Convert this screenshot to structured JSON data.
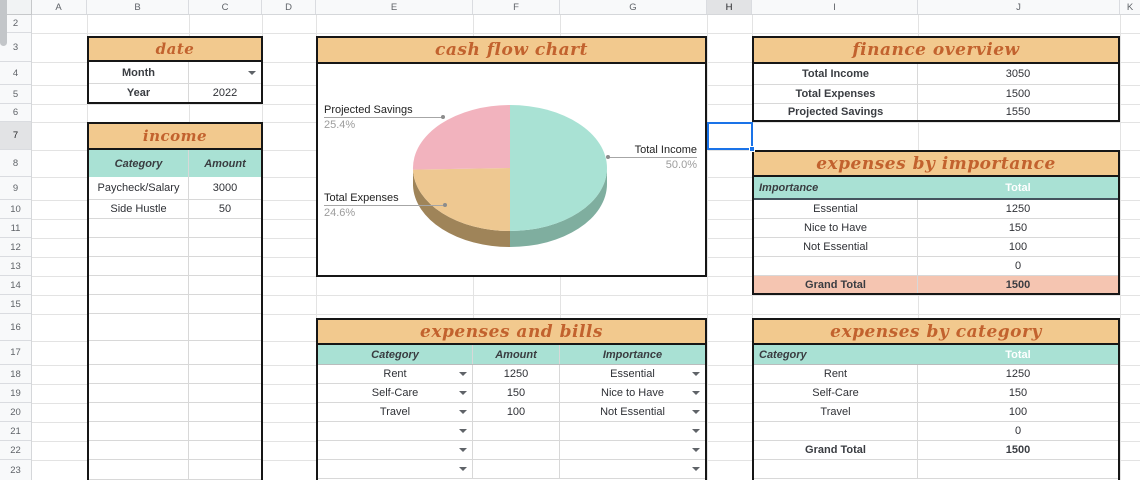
{
  "spreadsheet": {
    "column_headers": [
      "A",
      "B",
      "C",
      "D",
      "E",
      "F",
      "G",
      "H",
      "I",
      "J",
      "K"
    ],
    "row_headers": [
      "2",
      "3",
      "4",
      "5",
      "6",
      "7",
      "8",
      "9",
      "10",
      "11",
      "12",
      "13",
      "14",
      "15",
      "16",
      "17",
      "18",
      "19",
      "20",
      "21",
      "22",
      "23"
    ],
    "selected": {
      "column": "H",
      "row": "7"
    }
  },
  "date_table": {
    "title": "date",
    "month_label": "Month",
    "month_value": "",
    "year_label": "Year",
    "year_value": "2022"
  },
  "income_table": {
    "title": "income",
    "col1": "Category",
    "col2": "Amount",
    "rows": [
      {
        "category": "Paycheck/Salary",
        "amount": "3000"
      },
      {
        "category": "Side Hustle",
        "amount": "50"
      }
    ]
  },
  "cash_flow_chart": {
    "title": "cash flow chart",
    "labels": {
      "projected_savings": {
        "name": "Projected Savings",
        "pct": "25.4%"
      },
      "total_expenses": {
        "name": "Total Expenses",
        "pct": "24.6%"
      },
      "total_income": {
        "name": "Total Income",
        "pct": "50.0%"
      }
    }
  },
  "chart_data": {
    "type": "pie",
    "title": "cash flow chart",
    "slices": [
      {
        "label": "Total Income",
        "value": 50.0,
        "color": "#a9e2d4"
      },
      {
        "label": "Projected Savings",
        "value": 25.4,
        "color": "#f2b3be"
      },
      {
        "label": "Total Expenses",
        "value": 24.6,
        "color": "#eec891"
      }
    ],
    "style_3d": true,
    "legend": "outside-labels"
  },
  "finance_overview": {
    "title": "finance overview",
    "rows": [
      {
        "label": "Total Income",
        "value": "3050"
      },
      {
        "label": "Total Expenses",
        "value": "1500"
      },
      {
        "label": "Projected Savings",
        "value": "1550"
      }
    ]
  },
  "expenses_by_importance": {
    "title": "expenses by importance",
    "col1": "Importance",
    "col2": "Total",
    "rows": [
      {
        "label": "Essential",
        "value": "1250"
      },
      {
        "label": "Nice to Have",
        "value": "150"
      },
      {
        "label": "Not Essential",
        "value": "100"
      },
      {
        "label": "",
        "value": "0"
      }
    ],
    "grand_total_label": "Grand Total",
    "grand_total_value": "1500"
  },
  "expenses_and_bills": {
    "title": "expenses and bills",
    "col1": "Category",
    "col2": "Amount",
    "col3": "Importance",
    "rows": [
      {
        "category": "Rent",
        "amount": "1250",
        "importance": "Essential"
      },
      {
        "category": "Self-Care",
        "amount": "150",
        "importance": "Nice to Have"
      },
      {
        "category": "Travel",
        "amount": "100",
        "importance": "Not Essential"
      },
      {
        "category": "",
        "amount": "",
        "importance": ""
      },
      {
        "category": "",
        "amount": "",
        "importance": ""
      },
      {
        "category": "",
        "amount": "",
        "importance": ""
      }
    ]
  },
  "expenses_by_category": {
    "title": "expenses by category",
    "col1": "Category",
    "col2": "Total",
    "rows": [
      {
        "label": "Rent",
        "value": "1250"
      },
      {
        "label": "Self-Care",
        "value": "150"
      },
      {
        "label": "Travel",
        "value": "100"
      },
      {
        "label": "",
        "value": "0"
      }
    ],
    "grand_total_label": "Grand Total",
    "grand_total_value": "1500"
  },
  "colors": {
    "table_header_tan": "#f2c98e",
    "subheader_teal": "#a9e1d4",
    "grand_total_salmon": "#f5c5b1",
    "title_orange": "#c2622e",
    "selection_blue": "#1a73e8",
    "pie_income_teal": "#a9e2d4",
    "pie_savings_pink": "#f2b3be",
    "pie_expenses_tan": "#eec891",
    "pie_side_teal_dark": "#7fae9f",
    "pie_side_tan_dark": "#9f8459"
  }
}
